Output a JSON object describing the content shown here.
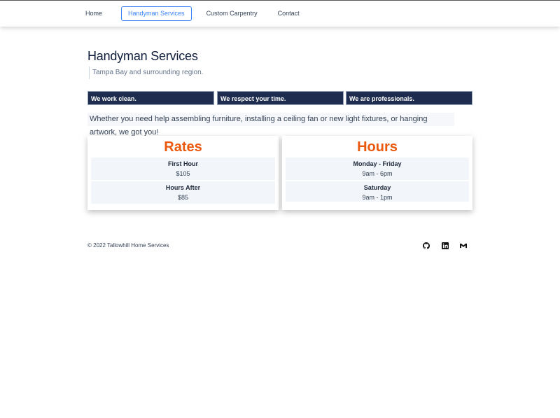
{
  "nav": {
    "items": [
      {
        "label": "Home"
      },
      {
        "label": "Handyman Services",
        "active": true
      },
      {
        "label": "Custom Carpentry"
      },
      {
        "label": "Contact"
      }
    ]
  },
  "header": {
    "title": "Handyman Services",
    "subtitle": "Tampa Bay and surrounding region."
  },
  "tags": [
    "We work clean.",
    "We respect your time.",
    "We are professionals."
  ],
  "intro": "Whether you need help assembling furniture, installing a ceiling fan or new light fixtures, or hanging artwork, we got you!",
  "rates": {
    "title": "Rates",
    "rows": [
      {
        "label": "First Hour",
        "value": "$105"
      },
      {
        "label": "Hours After",
        "value": "$85"
      }
    ]
  },
  "hours": {
    "title": "Hours",
    "rows": [
      {
        "label": "Monday - Friday",
        "value": "9am - 6pm"
      },
      {
        "label": "Saturday",
        "value": "9am - 1pm"
      }
    ]
  },
  "footer": {
    "copyright": "© 2022 Tallowhill Home Services",
    "icons": [
      "github-icon",
      "linkedin-icon",
      "gmail-icon"
    ]
  },
  "colors": {
    "accent": "#3b82f6",
    "heading_orange": "#ea580c",
    "tag_bg": "#1e2d4f"
  }
}
